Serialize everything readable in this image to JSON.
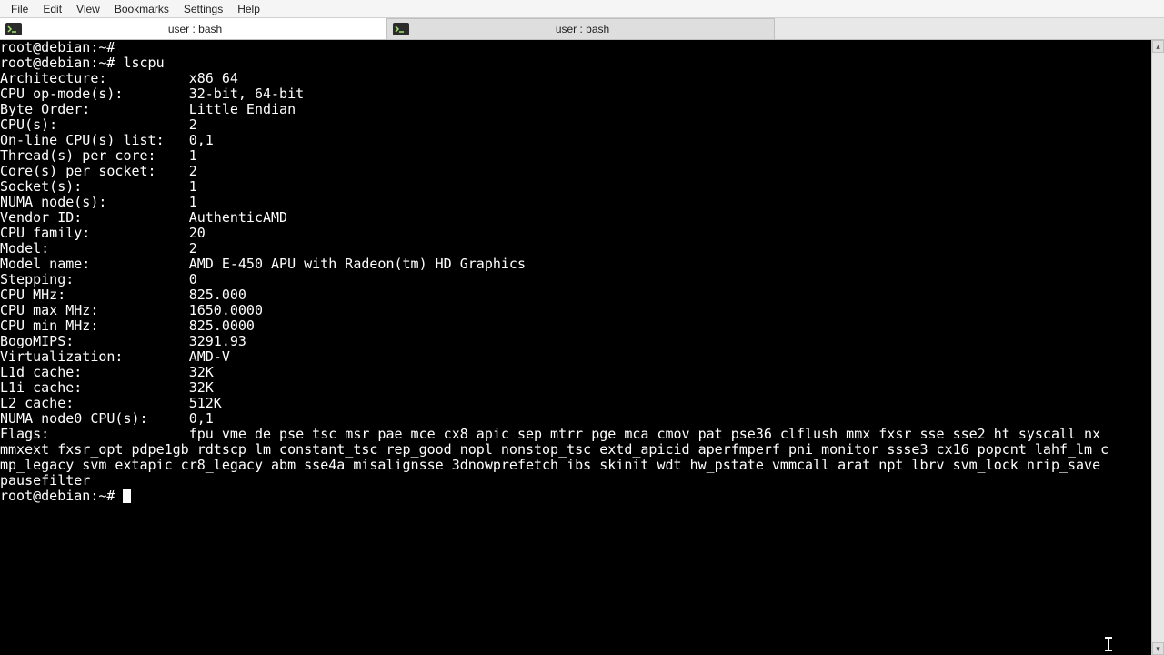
{
  "menubar": {
    "items": [
      "File",
      "Edit",
      "View",
      "Bookmarks",
      "Settings",
      "Help"
    ]
  },
  "tabs": [
    {
      "label": "user : bash",
      "active": true
    },
    {
      "label": "user : bash",
      "active": false
    }
  ],
  "terminal": {
    "prompt": "root@debian:~#",
    "command": "lscpu",
    "fields": [
      {
        "k": "Architecture:",
        "v": "x86_64"
      },
      {
        "k": "CPU op-mode(s):",
        "v": "32-bit, 64-bit"
      },
      {
        "k": "Byte Order:",
        "v": "Little Endian"
      },
      {
        "k": "CPU(s):",
        "v": "2"
      },
      {
        "k": "On-line CPU(s) list:",
        "v": "0,1"
      },
      {
        "k": "Thread(s) per core:",
        "v": "1"
      },
      {
        "k": "Core(s) per socket:",
        "v": "2"
      },
      {
        "k": "Socket(s):",
        "v": "1"
      },
      {
        "k": "NUMA node(s):",
        "v": "1"
      },
      {
        "k": "Vendor ID:",
        "v": "AuthenticAMD"
      },
      {
        "k": "CPU family:",
        "v": "20"
      },
      {
        "k": "Model:",
        "v": "2"
      },
      {
        "k": "Model name:",
        "v": "AMD E-450 APU with Radeon(tm) HD Graphics"
      },
      {
        "k": "Stepping:",
        "v": "0"
      },
      {
        "k": "CPU MHz:",
        "v": "825.000"
      },
      {
        "k": "CPU max MHz:",
        "v": "1650.0000"
      },
      {
        "k": "CPU min MHz:",
        "v": "825.0000"
      },
      {
        "k": "BogoMIPS:",
        "v": "3291.93"
      },
      {
        "k": "Virtualization:",
        "v": "AMD-V"
      },
      {
        "k": "L1d cache:",
        "v": "32K"
      },
      {
        "k": "L1i cache:",
        "v": "32K"
      },
      {
        "k": "L2 cache:",
        "v": "512K"
      },
      {
        "k": "NUMA node0 CPU(s):",
        "v": "0,1"
      }
    ],
    "flags_label": "Flags:",
    "flags_wrapped": [
      "fpu vme de pse tsc msr pae mce cx8 apic sep mtrr pge mca cmov pat pse36 clflush mmx fxsr sse sse2 ht syscall nx",
      "mmxext fxsr_opt pdpe1gb rdtscp lm constant_tsc rep_good nopl nonstop_tsc extd_apicid aperfmperf pni monitor ssse3 cx16 popcnt lahf_lm c",
      "mp_legacy svm extapic cr8_legacy abm sse4a misalignsse 3dnowprefetch ibs skinit wdt hw_pstate vmmcall arat npt lbrv svm_lock nrip_save",
      "pausefilter"
    ]
  }
}
